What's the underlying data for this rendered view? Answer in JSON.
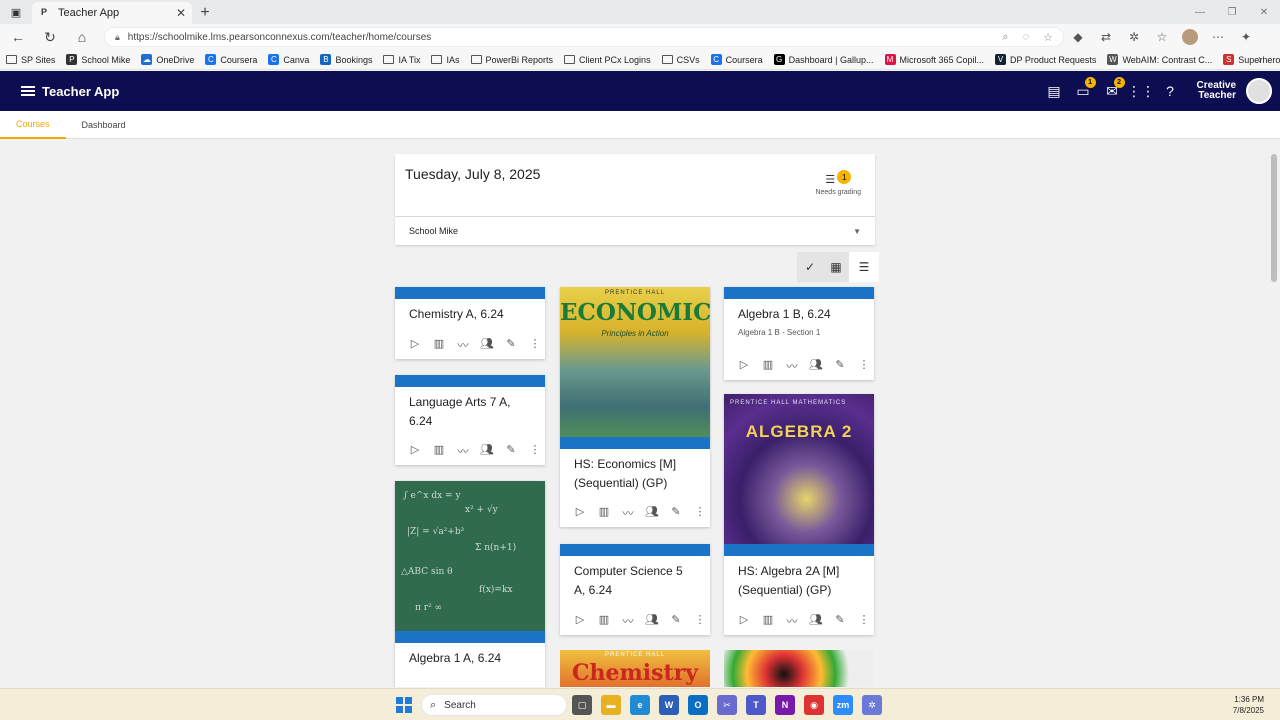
{
  "browser": {
    "tab_title": "Teacher App",
    "tab_favicon": "P",
    "url": "https://schoolmike.lms.pearsonconnexus.com/teacher/home/courses",
    "bookmarks": [
      {
        "label": "SP Sites",
        "icon": "folder"
      },
      {
        "label": "School Mike",
        "icon": "P"
      },
      {
        "label": "OneDrive",
        "icon": "cloud"
      },
      {
        "label": "Coursera",
        "icon": "C"
      },
      {
        "label": "Canva",
        "icon": "C"
      },
      {
        "label": "Bookings",
        "icon": "B"
      },
      {
        "label": "IA Tix",
        "icon": "folder"
      },
      {
        "label": "IAs",
        "icon": "folder"
      },
      {
        "label": "PowerBi Reports",
        "icon": "folder"
      },
      {
        "label": "Client PCx Logins",
        "icon": "folder"
      },
      {
        "label": "CSVs",
        "icon": "folder"
      },
      {
        "label": "Coursera",
        "icon": "C"
      },
      {
        "label": "Dashboard | Gallup...",
        "icon": "G"
      },
      {
        "label": "Microsoft 365 Copil...",
        "icon": "M"
      },
      {
        "label": "DP Product Requests",
        "icon": "V"
      },
      {
        "label": "WebAIM: Contrast C...",
        "icon": "W"
      },
      {
        "label": "Superheroes Back t...",
        "icon": "S"
      }
    ]
  },
  "app": {
    "title": "Teacher App",
    "user_line1": "Creative",
    "user_line2": "Teacher",
    "badges": {
      "tasks": "1",
      "messages": "2"
    },
    "colors": {
      "header": "#0d0e52",
      "accent": "#f4a900",
      "card_strip": "#1a73c7"
    }
  },
  "tabs": [
    {
      "label": "Courses",
      "active": true
    },
    {
      "label": "Dashboard",
      "active": false
    }
  ],
  "date_card": {
    "date": "Tuesday, July 8, 2025",
    "grading_count": "1",
    "grading_label": "Needs grading"
  },
  "school": {
    "name": "School Mike"
  },
  "courses": [
    {
      "title": "Chemistry A, 6.24",
      "subtitle": ""
    },
    {
      "title": "Language Arts 7 A, 6.24",
      "subtitle": ""
    },
    {
      "title": "Algebra 1 A, 6.24",
      "subtitle": ""
    },
    {
      "title": "HS: Economics [M] (Sequential) (GP)",
      "subtitle": "",
      "cover_publisher": "PRENTICE HALL",
      "cover_title": "ECONOMICS",
      "cover_subtitle": "Principles in Action"
    },
    {
      "title": "Computer Science 5 A, 6.24",
      "subtitle": ""
    },
    {
      "title": "Algebra 1 B, 6.24",
      "subtitle": "Algebra 1 B - Section 1"
    },
    {
      "title": "HS: Algebra 2A [M] (Sequential) (GP)",
      "subtitle": "",
      "cover_publisher": "PRENTICE HALL MATHEMATICS",
      "cover_title": "ALGEBRA 2"
    }
  ],
  "partial_covers": {
    "chem_publisher": "PRENTICE HALL",
    "chem_title": "Chemistry"
  },
  "taskbar": {
    "search_placeholder": "Search",
    "time": "1:36 PM",
    "date": "7/8/2025"
  }
}
